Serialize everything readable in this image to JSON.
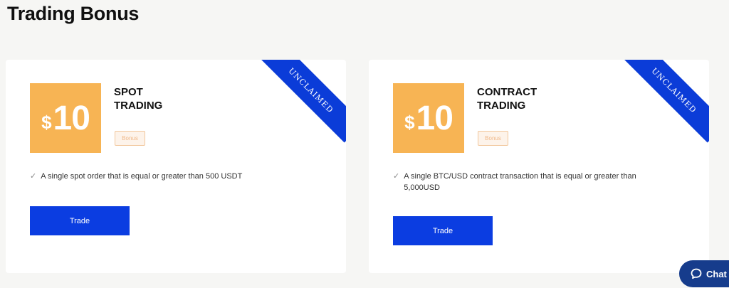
{
  "page": {
    "title": "Trading Bonus"
  },
  "cards": [
    {
      "ribbon": "UNCLAIMED",
      "currency_symbol": "$",
      "amount": "10",
      "title_line1": "SPOT",
      "title_line2": "TRADING",
      "status": "Bonus",
      "requirement": "A single spot order that is equal or greater than 500 USDT",
      "button_label": "Trade"
    },
    {
      "ribbon": "UNCLAIMED",
      "currency_symbol": "$",
      "amount": "10",
      "title_line1": "CONTRACT",
      "title_line2": "TRADING",
      "status": "Bonus",
      "requirement": "A single BTC/USD contract transaction that is equal or greater than 5,000USD",
      "button_label": "Trade"
    }
  ],
  "chat": {
    "label": "Chat"
  },
  "colors": {
    "accent": "#0b3de1",
    "badge": "#f7b454",
    "chat": "#163c8c"
  }
}
